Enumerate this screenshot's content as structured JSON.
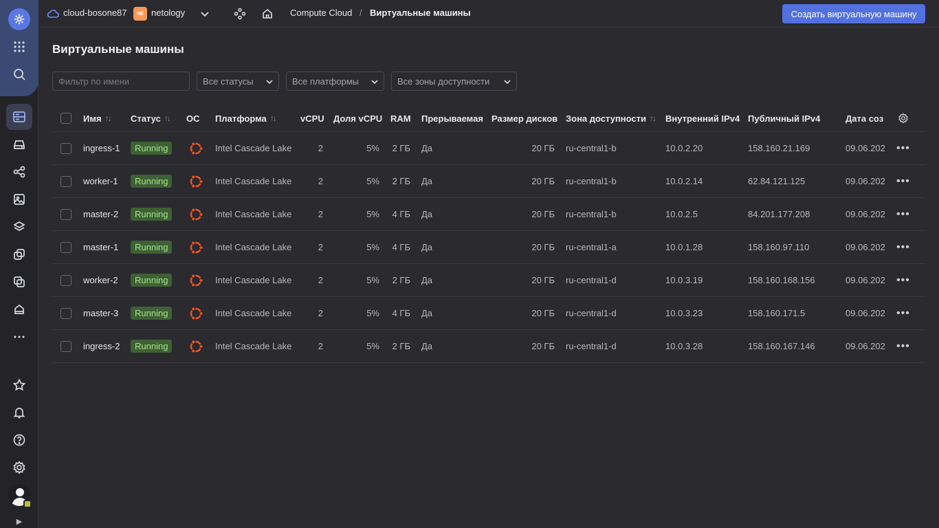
{
  "header": {
    "cloud_name": "cloud-bosone87",
    "org_badge": "NE",
    "org_name": "netology",
    "breadcrumb_service": "Compute Cloud",
    "breadcrumb_sep": "/",
    "breadcrumb_current": "Виртуальные машины",
    "create_button": "Создать виртуальную машину"
  },
  "page": {
    "title": "Виртуальные машины",
    "filter_placeholder": "Фильтр по имени",
    "status_select": "Все статусы",
    "platform_select": "Все платформы",
    "zone_select": "Все зоны доступности"
  },
  "table": {
    "columns": {
      "name": "Имя",
      "status": "Статус",
      "os": "ОС",
      "platform": "Платформа",
      "vcpu": "vCPU",
      "vcpu_share": "Доля vCPU",
      "ram": "RAM",
      "preemptible": "Прерываемая",
      "disk_size": "Размер дисков",
      "zone": "Зона доступности",
      "internal_ip": "Внутренний IPv4",
      "public_ip": "Публичный IPv4",
      "created": "Дата соз"
    },
    "sort_glyph": "↑↓",
    "row_menu": "•••",
    "rows": [
      {
        "name": "ingress-1",
        "status": "Running",
        "platform": "Intel Cascade Lake",
        "vcpu": "2",
        "share": "5%",
        "ram": "2 ГБ",
        "preemptible": "Да",
        "disk": "20 ГБ",
        "zone": "ru-central1-b",
        "internal": "10.0.2.20",
        "public": "158.160.21.169",
        "created": "09.06.202"
      },
      {
        "name": "worker-1",
        "status": "Running",
        "platform": "Intel Cascade Lake",
        "vcpu": "2",
        "share": "5%",
        "ram": "2 ГБ",
        "preemptible": "Да",
        "disk": "20 ГБ",
        "zone": "ru-central1-b",
        "internal": "10.0.2.14",
        "public": "62.84.121.125",
        "created": "09.06.202"
      },
      {
        "name": "master-2",
        "status": "Running",
        "platform": "Intel Cascade Lake",
        "vcpu": "2",
        "share": "5%",
        "ram": "4 ГБ",
        "preemptible": "Да",
        "disk": "20 ГБ",
        "zone": "ru-central1-b",
        "internal": "10.0.2.5",
        "public": "84.201.177.208",
        "created": "09.06.202"
      },
      {
        "name": "master-1",
        "status": "Running",
        "platform": "Intel Cascade Lake",
        "vcpu": "2",
        "share": "5%",
        "ram": "4 ГБ",
        "preemptible": "Да",
        "disk": "20 ГБ",
        "zone": "ru-central1-a",
        "internal": "10.0.1.28",
        "public": "158.160.97.110",
        "created": "09.06.202"
      },
      {
        "name": "worker-2",
        "status": "Running",
        "platform": "Intel Cascade Lake",
        "vcpu": "2",
        "share": "5%",
        "ram": "2 ГБ",
        "preemptible": "Да",
        "disk": "20 ГБ",
        "zone": "ru-central1-d",
        "internal": "10.0.3.19",
        "public": "158.160.168.156",
        "created": "09.06.202"
      },
      {
        "name": "master-3",
        "status": "Running",
        "platform": "Intel Cascade Lake",
        "vcpu": "2",
        "share": "5%",
        "ram": "4 ГБ",
        "preemptible": "Да",
        "disk": "20 ГБ",
        "zone": "ru-central1-d",
        "internal": "10.0.3.23",
        "public": "158.160.171.5",
        "created": "09.06.202"
      },
      {
        "name": "ingress-2",
        "status": "Running",
        "platform": "Intel Cascade Lake",
        "vcpu": "2",
        "share": "5%",
        "ram": "2 ГБ",
        "preemptible": "Да",
        "disk": "20 ГБ",
        "zone": "ru-central1-d",
        "internal": "10.0.3.28",
        "public": "158.160.167.146",
        "created": "09.06.202"
      }
    ]
  },
  "icons": {
    "os": "ubuntu-icon",
    "accent_color": "#5270e0",
    "status_color": "#a7e08a",
    "ubuntu_color": "#e95420"
  }
}
